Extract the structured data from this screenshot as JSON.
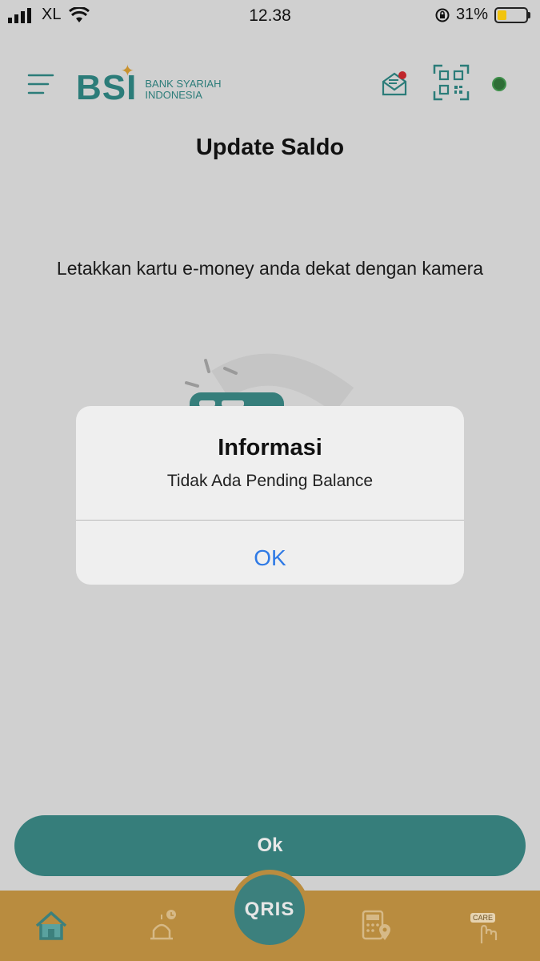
{
  "status_bar": {
    "carrier": "XL",
    "time": "12.38",
    "battery_percent_text": "31%",
    "battery_level": 0.31
  },
  "header": {
    "logo_text": "BSI",
    "logo_sub_line1": "BANK SYARIAH",
    "logo_sub_line2": "INDONESIA",
    "icons": [
      "menu-icon",
      "mail-icon",
      "qr-scan-icon",
      "status-dot"
    ]
  },
  "page": {
    "title": "Update Saldo",
    "instruction": "Letakkan kartu e-money anda dekat dengan kamera"
  },
  "dialog": {
    "title": "Informasi",
    "message": "Tidak Ada Pending Balance",
    "ok_label": "OK"
  },
  "footer": {
    "ok_button_label": "Ok"
  },
  "bottom_nav": {
    "items": [
      "home-icon",
      "mosque-icon",
      "qris-button",
      "calculator-location-icon",
      "care-icon"
    ],
    "qris_label": "QRIS",
    "care_label": "CARE"
  },
  "colors": {
    "brand_teal": "#367e7b",
    "brand_gold": "#b98c3f",
    "dialog_button": "#2f7ae5",
    "overlay_bg": "#d0d0d0"
  }
}
